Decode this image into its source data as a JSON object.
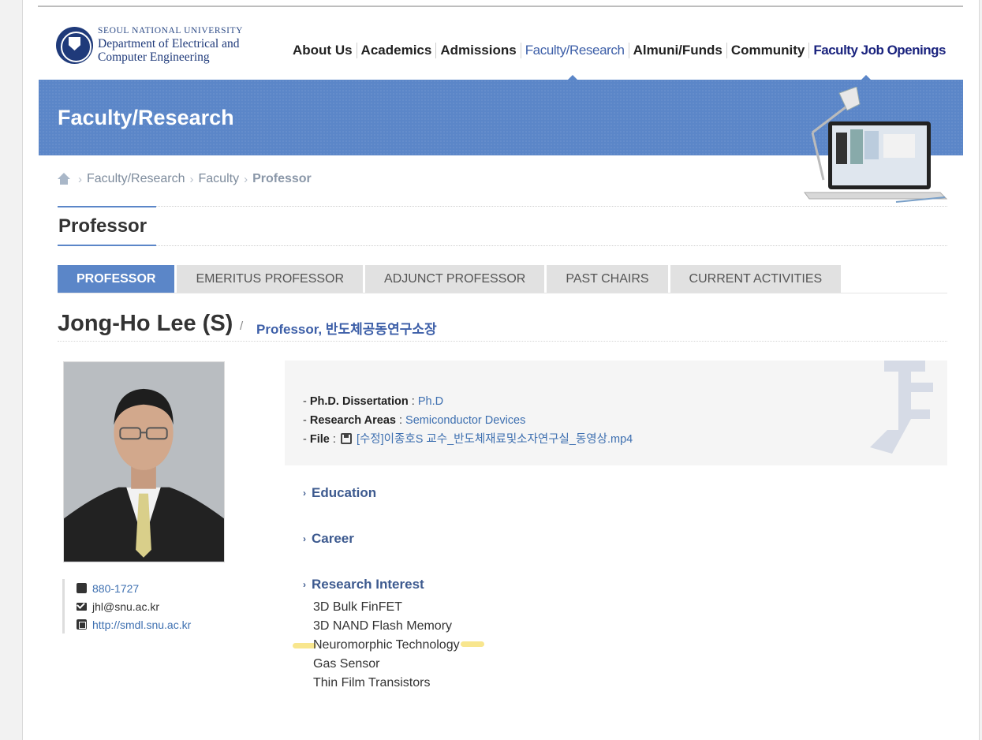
{
  "logo": {
    "university": "SEOUL NATIONAL UNIVERSITY",
    "dept_line1": "Department of Electrical and",
    "dept_line2": "Computer Engineering"
  },
  "nav": [
    "About Us",
    "Academics",
    "Admissions",
    "Faculty/Research",
    "Almuni/Funds",
    "Community",
    "Faculty Job Openings"
  ],
  "nav_active": "Faculty/Research",
  "banner": {
    "title": "Faculty/Research"
  },
  "breadcrumb": [
    "Faculty/Research",
    "Faculty",
    "Professor"
  ],
  "page_title": "Professor",
  "tabs": [
    "PROFESSOR",
    "EMERITUS PROFESSOR",
    "ADJUNCT PROFESSOR",
    "PAST CHAIRS",
    "CURRENT ACTIVITIES"
  ],
  "active_tab": "PROFESSOR",
  "profile": {
    "name": "Jong-Ho Lee (S)",
    "slash": "/",
    "position": "Professor, 반도체공동연구소장"
  },
  "contact": {
    "phone": "880-1727",
    "email": "jhl@snu.ac.kr",
    "website": "http://smdl.snu.ac.kr"
  },
  "info": {
    "dissertation_label": "Ph.D. Dissertation",
    "dissertation_value": "Ph.D",
    "research_label": "Research Areas",
    "research_value": "Semiconductor Devices",
    "file_label": "File",
    "file_value": "[수정]이종호S 교수_반도체재료및소자연구실_동영상.mp4"
  },
  "sections": {
    "education": "Education",
    "career": "Career",
    "research_interest": "Research Interest"
  },
  "research_interests": [
    "3D Bulk FinFET",
    "3D NAND Flash Memory",
    "Neuromorphic Technology",
    "Gas Sensor",
    "Thin Film Transistors"
  ],
  "colors": {
    "accent": "#5b86c8",
    "link": "#3d6fb0",
    "heading": "#3d5a8f",
    "highlight": "#f7e27a"
  }
}
